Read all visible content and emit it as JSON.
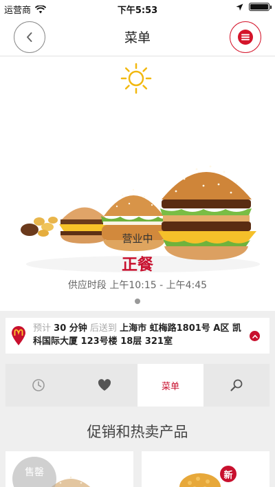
{
  "status_bar": {
    "carrier": "运营商",
    "time": "下午5:53"
  },
  "nav": {
    "title": "菜单",
    "back_icon": "chevron-left-icon",
    "menu_icon": "list-icon"
  },
  "hero": {
    "weather_icon": "sun-icon",
    "status": "营业中",
    "meal": "正餐",
    "hours": "供应时段 上午10:15 - 上午4:45",
    "page_indicator": {
      "total": 1,
      "current": 1
    }
  },
  "delivery": {
    "est_label": "预计",
    "est_value": "30 分钟",
    "deliver_label": "后送到",
    "address": "上海市 虹梅路1801号 A区 凯科国际大厦 123号楼 18层 321室"
  },
  "tabs": [
    {
      "label": "",
      "icon": "clock-icon",
      "active": false
    },
    {
      "label": "",
      "icon": "heart-icon",
      "active": false
    },
    {
      "label": "菜单",
      "icon": "",
      "active": true
    },
    {
      "label": "",
      "icon": "search-icon",
      "active": false
    }
  ],
  "section": {
    "title": "促销和热卖产品"
  },
  "products": [
    {
      "badge": "售罄"
    },
    {
      "badge": "新"
    }
  ],
  "colors": {
    "accent": "#c8102e",
    "background": "#efefef"
  }
}
